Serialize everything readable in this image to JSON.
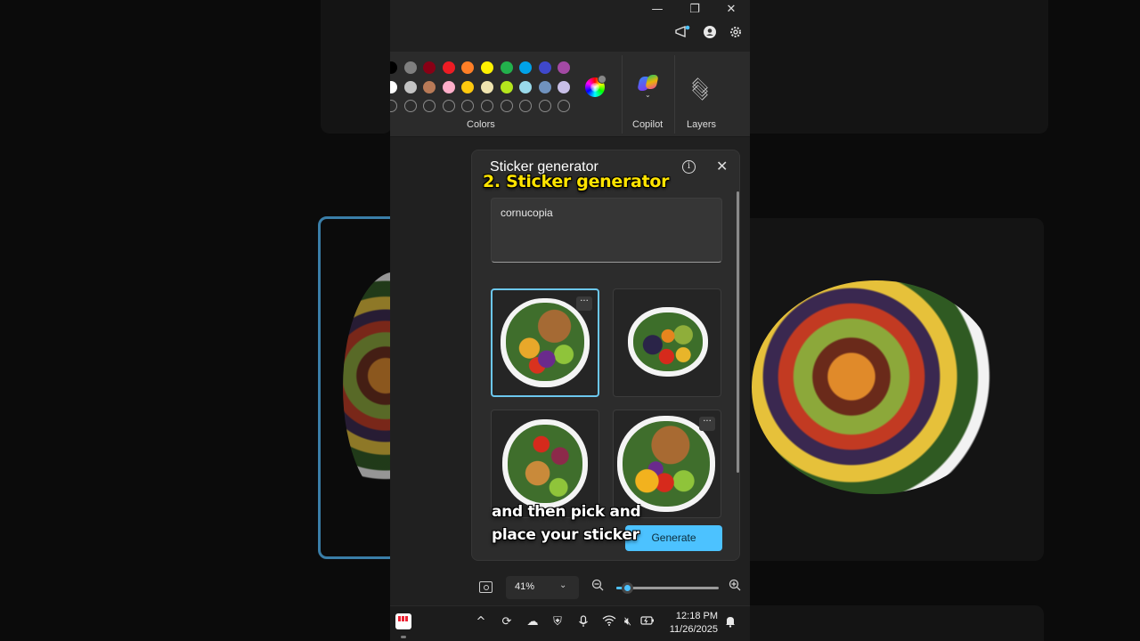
{
  "window": {
    "minimize_glyph": "—",
    "restore_glyph": "❐",
    "close_glyph": "✕"
  },
  "ribbon": {
    "colors_label": "Colors",
    "copilot_label": "Copilot",
    "layers_label": "Layers",
    "swatches_row1": [
      "#000000",
      "#7f7f7f",
      "#880015",
      "#ed1c24",
      "#ff7f27",
      "#fff200",
      "#22b14c",
      "#00a2e8",
      "#3f48cc",
      "#a349a4"
    ],
    "swatches_row2": [
      "#ffffff",
      "#c3c3c3",
      "#b97a57",
      "#ffaec9",
      "#ffc90e",
      "#efe4b0",
      "#b5e61d",
      "#99d9ea",
      "#7092be",
      "#c8bfe7"
    ]
  },
  "sticker_panel": {
    "title": "Sticker generator",
    "prompt_value": "cornucopia",
    "more_glyph": "···",
    "generate_label": "Generate",
    "info_glyph": "i",
    "close_glyph": "✕"
  },
  "zoom": {
    "level_label": "41%",
    "level_fraction": 0.1,
    "chevron": "⌄"
  },
  "taskbar": {
    "time": "12:18 PM",
    "date": "11/26/2025"
  },
  "overlay": {
    "step_caption": "2. Sticker generator",
    "subtitle_line1": "and then pick and",
    "subtitle_line2": "place your sticker"
  }
}
